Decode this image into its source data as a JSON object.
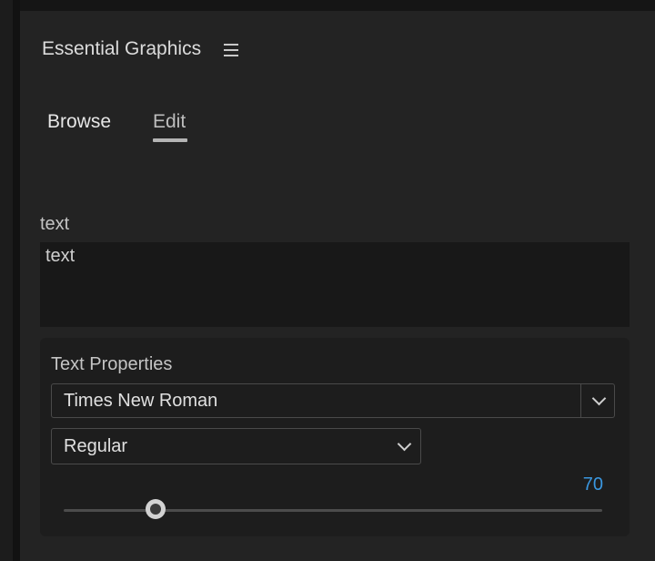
{
  "panel": {
    "title": "Essential Graphics",
    "menu_icon": "hamburger-menu-icon"
  },
  "tabs": [
    {
      "label": "Browse",
      "active": false
    },
    {
      "label": "Edit",
      "active": true
    }
  ],
  "layer": {
    "label": "text",
    "value": "text"
  },
  "text_properties": {
    "title": "Text Properties",
    "font_family": "Times New Roman",
    "font_style": "Regular",
    "font_size": "70",
    "font_size_slider_fraction": 0.17
  },
  "colors": {
    "background": "#232323",
    "accent_value": "#3a97e0"
  }
}
